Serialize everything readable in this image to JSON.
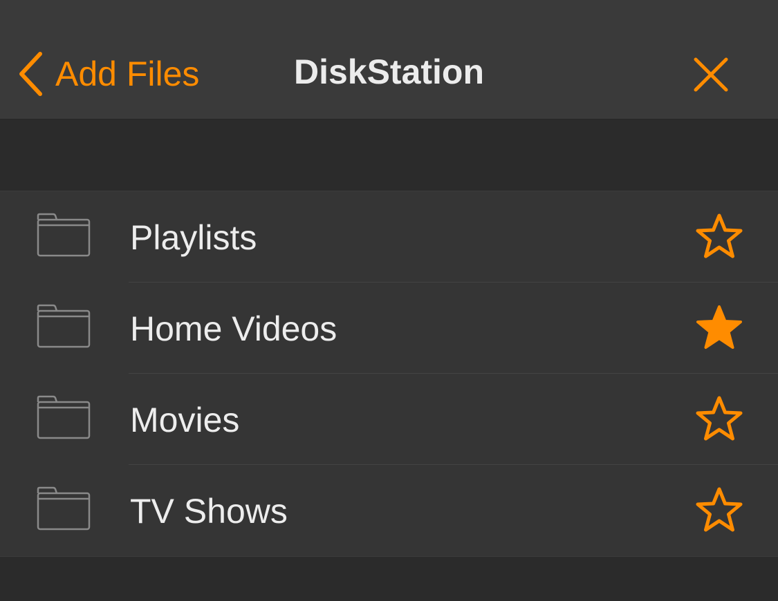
{
  "navbar": {
    "back_label": "Add Files",
    "title": "DiskStation",
    "back_icon": "chevron-left-icon",
    "close_icon": "close-icon"
  },
  "items": [
    {
      "label": "Playlists",
      "icon": "folder-icon",
      "favorite": false
    },
    {
      "label": "Home Videos",
      "icon": "folder-icon",
      "favorite": true
    },
    {
      "label": "Movies",
      "icon": "folder-icon",
      "favorite": false
    },
    {
      "label": "TV Shows",
      "icon": "folder-icon",
      "favorite": false
    }
  ],
  "colors": {
    "accent": "#ff8c00",
    "navbar_bg": "#3a3a3a",
    "list_bg": "#353535",
    "background": "#2b2b2b",
    "text": "#ededed",
    "folder_stroke": "#8a8a8a"
  }
}
